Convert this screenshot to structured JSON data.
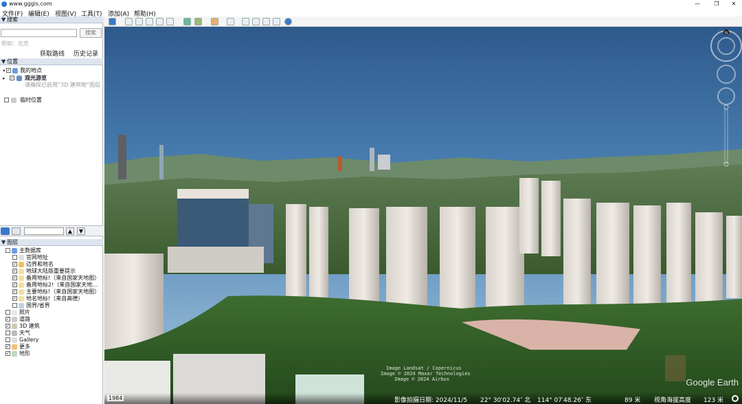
{
  "window": {
    "title": "www.gggis.com"
  },
  "menu": [
    "文件(F)",
    "编辑(E)",
    "视图(V)",
    "工具(T)",
    "添加(A)",
    "帮助(H)"
  ],
  "search": {
    "header": "搜索",
    "placeholder": "",
    "button": "搜索",
    "hint": "例如：北京",
    "get_route": "获取路线",
    "history": "历史记录"
  },
  "places": {
    "header": "位置",
    "items": [
      {
        "label": "我的地点",
        "checked": true
      },
      {
        "label": "观光游览",
        "checked": true
      },
      {
        "label": "请确保已启用“3D 建筑物”图层",
        "checked": false
      },
      {
        "label": "临时位置",
        "checked": false
      }
    ]
  },
  "layers": {
    "header": "图层",
    "items": [
      {
        "label": "主数据库",
        "checked": false
      },
      {
        "label": "官网地址",
        "checked": false
      },
      {
        "label": "边界和地名",
        "checked": true
      },
      {
        "label": "地球大陆版重要提示",
        "checked": true
      },
      {
        "label": "备用地标!（来自国家天地图）",
        "checked": true
      },
      {
        "label": "备用地标2!（来自国家天地…",
        "checked": true
      },
      {
        "label": "主要地标!（来自国家天地图）",
        "checked": true
      },
      {
        "label": "地名地标!（来自高德）",
        "checked": true
      },
      {
        "label": "国界/省界",
        "checked": false
      },
      {
        "label": "照片",
        "checked": false
      },
      {
        "label": "道路",
        "checked": true
      },
      {
        "label": "3D 建筑",
        "checked": true
      },
      {
        "label": "天气",
        "checked": false
      },
      {
        "label": "Gallery",
        "checked": false
      },
      {
        "label": "更多",
        "checked": true
      },
      {
        "label": "地形",
        "checked": true
      }
    ]
  },
  "status": {
    "date": "影像拍摄日期: 2024/11/5",
    "lat": "22° 30′02.74″ 北",
    "lon": "114° 07′48.26″ 东",
    "elev": "89 米",
    "eye_alt": "视角海拔高度",
    "eye_val": "123 米"
  },
  "copyright": [
    "Image Landsat / Copernicus",
    "Image © 2024 Maxar Technologies",
    "Image © 2024 Airbus"
  ],
  "logo": "Google Earth",
  "compass_label": "N",
  "bottom_left": "1984"
}
